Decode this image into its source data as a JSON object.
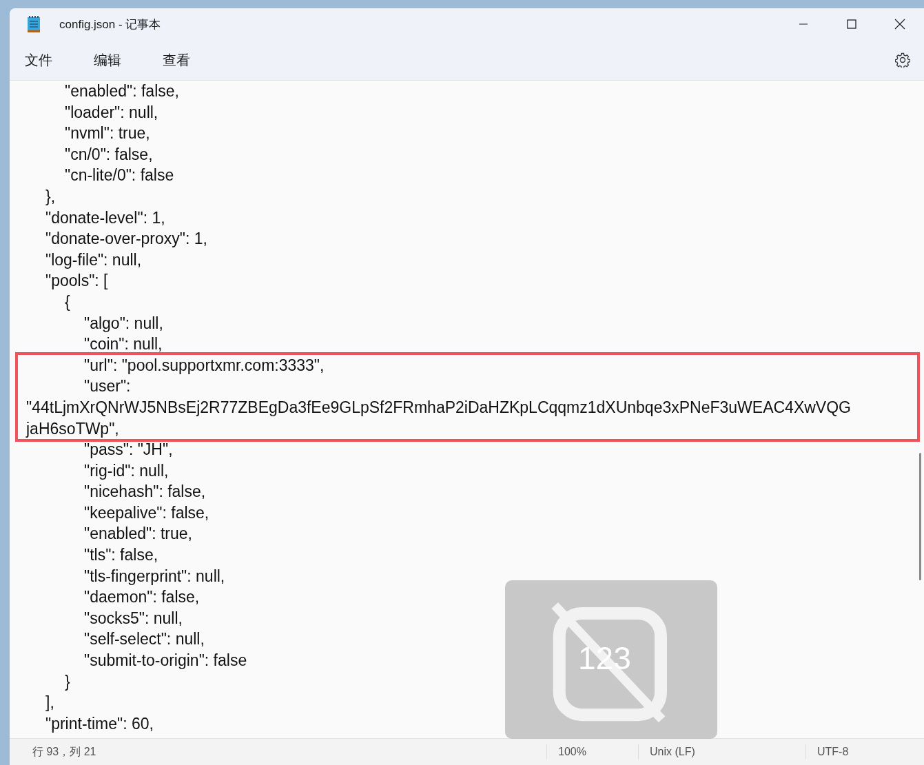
{
  "window": {
    "title": "config.json - 记事本"
  },
  "menu": [
    "文件",
    "编辑",
    "查看"
  ],
  "lines": [
    {
      "text": "\t\t\"enabled\": false,",
      "highlighted": false
    },
    {
      "text": "\t\t\"loader\": null,",
      "highlighted": false
    },
    {
      "text": "\t\t\"nvml\": true,",
      "highlighted": false
    },
    {
      "text": "\t\t\"cn/0\": false,",
      "highlighted": false
    },
    {
      "text": "\t\t\"cn-lite/0\": false",
      "highlighted": false
    },
    {
      "text": "\t},",
      "highlighted": false
    },
    {
      "text": "\t\"donate-level\": 1,",
      "highlighted": false
    },
    {
      "text": "\t\"donate-over-proxy\": 1,",
      "highlighted": false
    },
    {
      "text": "\t\"log-file\": null,",
      "highlighted": false
    },
    {
      "text": "\t\"pools\": [",
      "highlighted": false
    },
    {
      "text": "\t\t{",
      "highlighted": false
    },
    {
      "text": "\t\t\t\"algo\": null,",
      "highlighted": false
    },
    {
      "text": "\t\t\t\"coin\": null,",
      "highlighted": false
    },
    {
      "text": "\t\t\t\"url\": \"pool.supportxmr.com:3333\",",
      "highlighted": true
    },
    {
      "text": "\t\t\t\"user\":",
      "highlighted": true
    },
    {
      "text": "\"44tLjmXrQNrWJ5NBsEj2R77ZBEgDa3fEe9GLpSf2FRmhaP2iDaHZKpLCqqmz1dXUnbqe3xPNeF3uWEAC4XwVQG",
      "highlighted": true
    },
    {
      "text": "jaH6soTWp\",",
      "highlighted": true
    },
    {
      "text": "\t\t\t\"pass\": \"JH\",",
      "highlighted": false
    },
    {
      "text": "\t\t\t\"rig-id\": null,",
      "highlighted": false
    },
    {
      "text": "\t\t\t\"nicehash\": false,",
      "highlighted": false
    },
    {
      "text": "\t\t\t\"keepalive\": false,",
      "highlighted": false
    },
    {
      "text": "\t\t\t\"enabled\": true,",
      "highlighted": false
    },
    {
      "text": "\t\t\t\"tls\": false,",
      "highlighted": false
    },
    {
      "text": "\t\t\t\"tls-fingerprint\": null,",
      "highlighted": false
    },
    {
      "text": "\t\t\t\"daemon\": false,",
      "highlighted": false
    },
    {
      "text": "\t\t\t\"socks5\": null,",
      "highlighted": false
    },
    {
      "text": "\t\t\t\"self-select\": null,",
      "highlighted": false
    },
    {
      "text": "\t\t\t\"submit-to-origin\": false",
      "highlighted": false
    },
    {
      "text": "\t\t}",
      "highlighted": false
    },
    {
      "text": "\t],",
      "highlighted": false
    },
    {
      "text": "\t\"print-time\": 60,",
      "highlighted": false
    }
  ],
  "status_bar": {
    "position": "行 93，列 21",
    "zoom": "100%",
    "line_ending": "Unix (LF)",
    "encoding": "UTF-8"
  },
  "overlay": {
    "label": "123"
  }
}
